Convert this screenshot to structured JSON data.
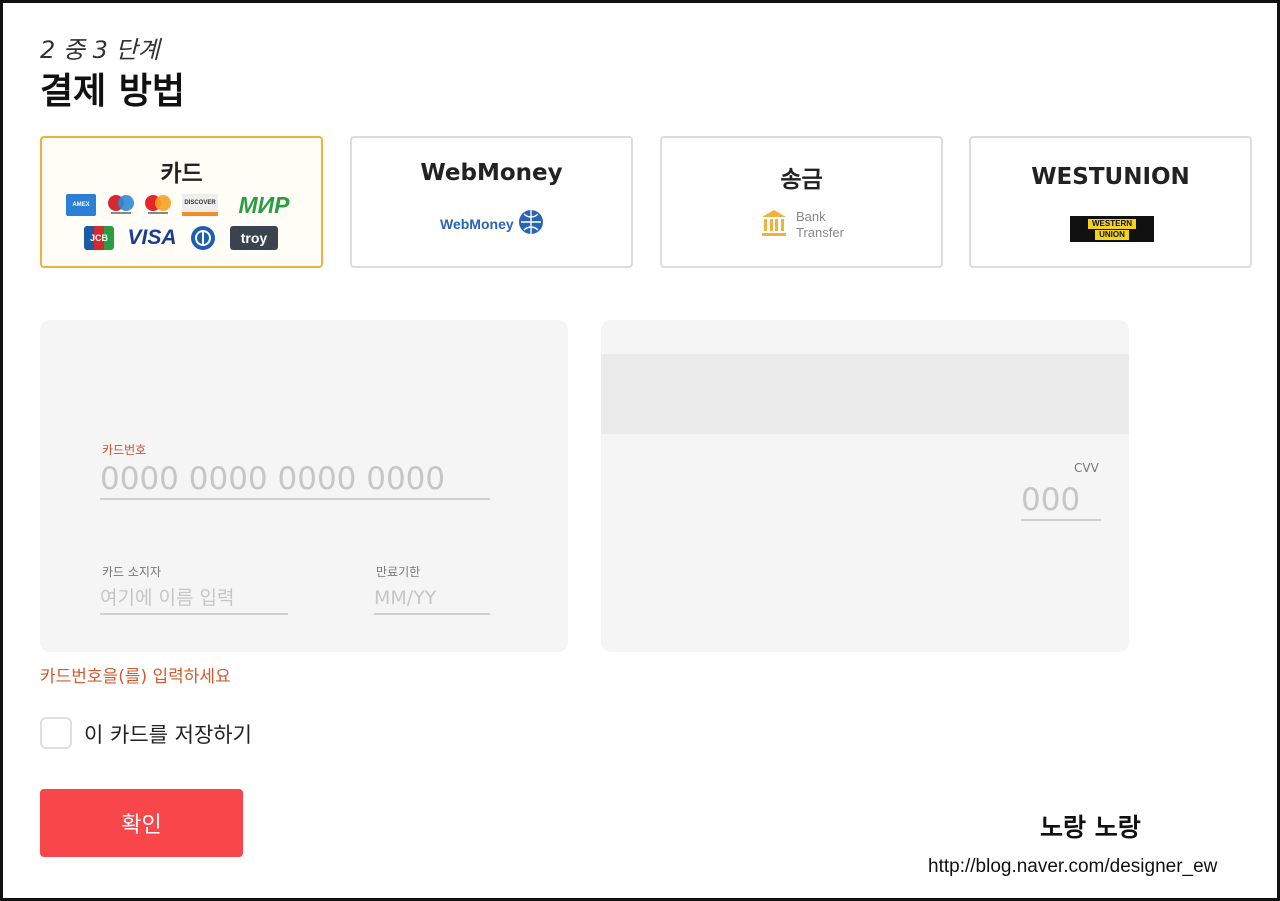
{
  "header": {
    "step": "2 중 3 단계",
    "title": "결제 방법"
  },
  "methods": [
    {
      "label": "카드",
      "selected": true,
      "logos": [
        "AMEX",
        "",
        "",
        "DISCOVER",
        "МИР",
        "JCB",
        "VISA",
        "",
        "troy"
      ]
    },
    {
      "label": "WebMoney",
      "logo_text": "WebMoney"
    },
    {
      "label": "송금",
      "logo_line1": "Bank",
      "logo_line2": "Transfer"
    },
    {
      "label": "WESTUNION",
      "logo_line1": "WESTERN",
      "logo_line2": "UNION"
    }
  ],
  "form": {
    "card_number_label": "카드번호",
    "card_number_placeholder": "0000 0000 0000 0000",
    "holder_label": "카드 소지자",
    "holder_placeholder": "여기에 이름 입력",
    "expiry_label": "만료기한",
    "expiry_placeholder": "MM/YY",
    "cvv_label": "CVV",
    "cvv_placeholder": "000"
  },
  "error": "카드번호을(를) 입력하세요",
  "save_card_label": "이 카드를 저장하기",
  "save_card_checked": false,
  "confirm_label": "확인",
  "watermark": {
    "name": "노랑 노랑",
    "url": "http://blog.naver.com/designer_ew"
  },
  "colors": {
    "selected_border": "#f0b23a",
    "confirm_button": "#f9464a",
    "error_text": "#d45a2e"
  }
}
